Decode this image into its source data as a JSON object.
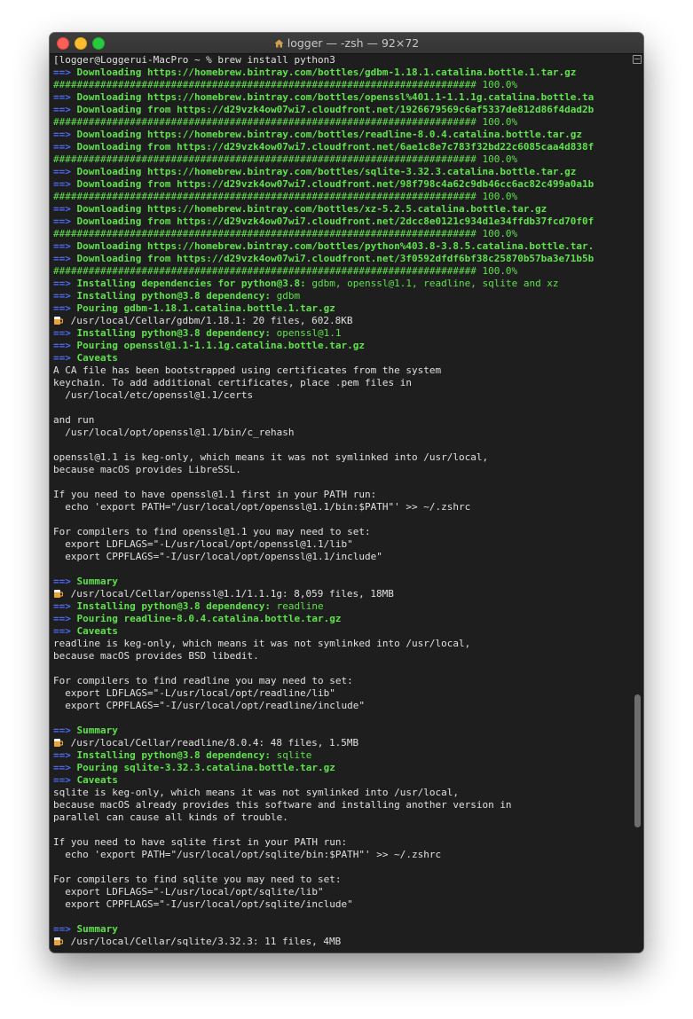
{
  "window": {
    "title": "logger — -zsh — 92×72"
  },
  "colors": {
    "green": "#5fe24c",
    "blue_arrow": "#4d6cf2",
    "text": "#e0e0e0",
    "background": "#1e1e1e"
  },
  "icons": {
    "beer_mug": "beer-mug-icon",
    "home": "house-icon"
  },
  "terminal": {
    "lines": [
      {
        "t": "plain",
        "text": "[logger@Loggerui-MacPro ~ % brew install python3"
      },
      {
        "t": "ar",
        "text": "Downloading https://homebrew.bintray.com/bottles/gdbm-1.18.1.catalina.bottle.1.tar.gz"
      },
      {
        "t": "hash",
        "text": "######################################################################## 100.0%"
      },
      {
        "t": "ar",
        "text": "Downloading https://homebrew.bintray.com/bottles/openssl%401.1-1.1.1g.catalina.bottle.ta"
      },
      {
        "t": "ar",
        "text": "Downloading from https://d29vzk4ow07wi7.cloudfront.net/1926679569c6af5337de812d86f4dad2b"
      },
      {
        "t": "hash",
        "text": "######################################################################## 100.0%"
      },
      {
        "t": "ar",
        "text": "Downloading https://homebrew.bintray.com/bottles/readline-8.0.4.catalina.bottle.tar.gz"
      },
      {
        "t": "ar",
        "text": "Downloading from https://d29vzk4ow07wi7.cloudfront.net/6ae1c8e7c783f32bd22c6085caa4d838f"
      },
      {
        "t": "hash",
        "text": "######################################################################## 100.0%"
      },
      {
        "t": "ar",
        "text": "Downloading https://homebrew.bintray.com/bottles/sqlite-3.32.3.catalina.bottle.tar.gz"
      },
      {
        "t": "ar",
        "text": "Downloading from https://d29vzk4ow07wi7.cloudfront.net/98f798c4a62c9db46cc6ac82c499a0a1b"
      },
      {
        "t": "hash",
        "text": "######################################################################## 100.0%"
      },
      {
        "t": "ar",
        "text": "Downloading https://homebrew.bintray.com/bottles/xz-5.2.5.catalina.bottle.tar.gz"
      },
      {
        "t": "ar",
        "text": "Downloading from https://d29vzk4ow07wi7.cloudfront.net/2dcc8e0121c934d1e34ffdb37fcd70f0f"
      },
      {
        "t": "hash",
        "text": "######################################################################## 100.0%"
      },
      {
        "t": "ar",
        "text": "Downloading https://homebrew.bintray.com/bottles/python%403.8-3.8.5.catalina.bottle.tar."
      },
      {
        "t": "ar",
        "text": "Downloading from https://d29vzk4ow07wi7.cloudfront.net/3f0592dfdf6bf38c25870b57ba3e71b5b"
      },
      {
        "t": "hash",
        "text": "######################################################################## 100.0%"
      },
      {
        "t": "ar",
        "text": "Installing dependencies for python@3.8: ",
        "rest": "gdbm, openssl@1.1, readline, sqlite and xz"
      },
      {
        "t": "ar",
        "text": "Installing python@3.8 dependency: ",
        "rest": "gdbm"
      },
      {
        "t": "arw",
        "text": "Pouring gdbm-1.18.1.catalina.bottle.1.tar.gz"
      },
      {
        "t": "mug",
        "text": "/usr/local/Cellar/gdbm/1.18.1: 20 files, 602.8KB"
      },
      {
        "t": "ar",
        "text": "Installing python@3.8 dependency: ",
        "rest": "openssl@1.1"
      },
      {
        "t": "arw",
        "text": "Pouring openssl@1.1-1.1.1g.catalina.bottle.tar.gz"
      },
      {
        "t": "arw",
        "text": "Caveats"
      },
      {
        "t": "plain",
        "text": "A CA file has been bootstrapped using certificates from the system"
      },
      {
        "t": "plain",
        "text": "keychain. To add additional certificates, place .pem files in"
      },
      {
        "t": "plain",
        "text": "  /usr/local/etc/openssl@1.1/certs"
      },
      {
        "t": "plain",
        "text": ""
      },
      {
        "t": "plain",
        "text": "and run"
      },
      {
        "t": "plain",
        "text": "  /usr/local/opt/openssl@1.1/bin/c_rehash"
      },
      {
        "t": "plain",
        "text": ""
      },
      {
        "t": "plain",
        "text": "openssl@1.1 is keg-only, which means it was not symlinked into /usr/local,"
      },
      {
        "t": "plain",
        "text": "because macOS provides LibreSSL."
      },
      {
        "t": "plain",
        "text": ""
      },
      {
        "t": "plain",
        "text": "If you need to have openssl@1.1 first in your PATH run:"
      },
      {
        "t": "plain",
        "text": "  echo 'export PATH=\"/usr/local/opt/openssl@1.1/bin:$PATH\"' >> ~/.zshrc"
      },
      {
        "t": "plain",
        "text": ""
      },
      {
        "t": "plain",
        "text": "For compilers to find openssl@1.1 you may need to set:"
      },
      {
        "t": "plain",
        "text": "  export LDFLAGS=\"-L/usr/local/opt/openssl@1.1/lib\""
      },
      {
        "t": "plain",
        "text": "  export CPPFLAGS=\"-I/usr/local/opt/openssl@1.1/include\""
      },
      {
        "t": "plain",
        "text": ""
      },
      {
        "t": "arw",
        "text": "Summary"
      },
      {
        "t": "mug",
        "text": "/usr/local/Cellar/openssl@1.1/1.1.1g: 8,059 files, 18MB"
      },
      {
        "t": "ar",
        "text": "Installing python@3.8 dependency: ",
        "rest": "readline"
      },
      {
        "t": "arw",
        "text": "Pouring readline-8.0.4.catalina.bottle.tar.gz"
      },
      {
        "t": "arw",
        "text": "Caveats"
      },
      {
        "t": "plain",
        "text": "readline is keg-only, which means it was not symlinked into /usr/local,"
      },
      {
        "t": "plain",
        "text": "because macOS provides BSD libedit."
      },
      {
        "t": "plain",
        "text": ""
      },
      {
        "t": "plain",
        "text": "For compilers to find readline you may need to set:"
      },
      {
        "t": "plain",
        "text": "  export LDFLAGS=\"-L/usr/local/opt/readline/lib\""
      },
      {
        "t": "plain",
        "text": "  export CPPFLAGS=\"-I/usr/local/opt/readline/include\""
      },
      {
        "t": "plain",
        "text": ""
      },
      {
        "t": "arw",
        "text": "Summary"
      },
      {
        "t": "mug",
        "text": "/usr/local/Cellar/readline/8.0.4: 48 files, 1.5MB"
      },
      {
        "t": "ar",
        "text": "Installing python@3.8 dependency: ",
        "rest": "sqlite"
      },
      {
        "t": "arw",
        "text": "Pouring sqlite-3.32.3.catalina.bottle.tar.gz"
      },
      {
        "t": "arw",
        "text": "Caveats"
      },
      {
        "t": "plain",
        "text": "sqlite is keg-only, which means it was not symlinked into /usr/local,"
      },
      {
        "t": "plain",
        "text": "because macOS already provides this software and installing another version in"
      },
      {
        "t": "plain",
        "text": "parallel can cause all kinds of trouble."
      },
      {
        "t": "plain",
        "text": ""
      },
      {
        "t": "plain",
        "text": "If you need to have sqlite first in your PATH run:"
      },
      {
        "t": "plain",
        "text": "  echo 'export PATH=\"/usr/local/opt/sqlite/bin:$PATH\"' >> ~/.zshrc"
      },
      {
        "t": "plain",
        "text": ""
      },
      {
        "t": "plain",
        "text": "For compilers to find sqlite you may need to set:"
      },
      {
        "t": "plain",
        "text": "  export LDFLAGS=\"-L/usr/local/opt/sqlite/lib\""
      },
      {
        "t": "plain",
        "text": "  export CPPFLAGS=\"-I/usr/local/opt/sqlite/include\""
      },
      {
        "t": "plain",
        "text": ""
      },
      {
        "t": "arw",
        "text": "Summary"
      },
      {
        "t": "mug",
        "text": "/usr/local/Cellar/sqlite/3.32.3: 11 files, 4MB"
      }
    ]
  }
}
